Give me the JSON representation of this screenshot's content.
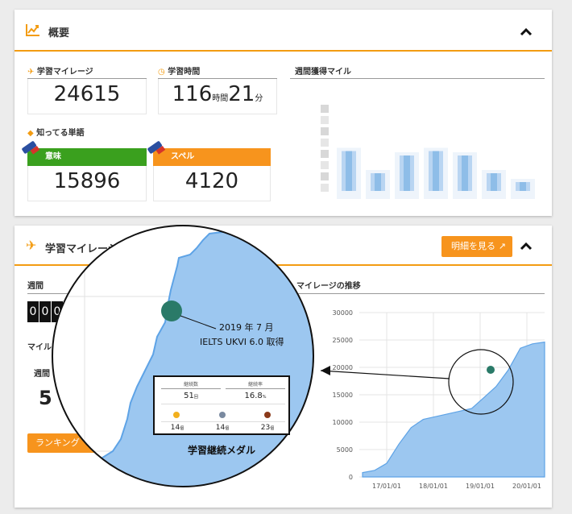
{
  "overview": {
    "title": "概要",
    "study_mileage_label": "学習マイレージ",
    "study_mileage_value": "24615",
    "study_time_label": "学習時間",
    "study_hours": "116",
    "hours_unit": "時間",
    "study_minutes": "21",
    "minutes_unit": "分",
    "weekly_label": "週間獲得マイル",
    "known_words_label": "知ってる単語",
    "meaning_label": "意味",
    "meaning_value": "15896",
    "spelling_label": "スペル",
    "spelling_value": "4120"
  },
  "mileage": {
    "title": "学習マイレージ",
    "details_button": "明細を見る",
    "week_label": "週間",
    "mile_label": "マイル",
    "week_label_2": "週間",
    "digits": [
      "0",
      "0",
      "0"
    ],
    "partial_number": "5",
    "ranking_button": "ランキング",
    "trend_label": "マイレージの推移"
  },
  "zoom": {
    "annotation_line1": "2019 年 7 月",
    "annotation_line2": "IELTS UKVI 6.0 取得",
    "medal_title": "学習継続メダル",
    "medal_col1_head": "継続数",
    "medal_col1_value": "51",
    "medal_col1_unit": "回",
    "medal_col2_head": "継続率",
    "medal_col2_value": "16.8",
    "medal_col2_unit": "%",
    "medals": [
      {
        "value": "14",
        "unit": "個",
        "color": "#f2b01e"
      },
      {
        "value": "14",
        "unit": "個",
        "color": "#7a8aa0"
      },
      {
        "value": "23",
        "unit": "個",
        "color": "#8b3a1a"
      }
    ]
  },
  "chart_data": {
    "type": "area",
    "ylim": [
      0,
      30000
    ],
    "yticks": [
      "0",
      "5000",
      "10000",
      "15000",
      "20000",
      "25000",
      "30000"
    ],
    "xticks": [
      "17/01/01",
      "18/01/01",
      "19/01/01",
      "20/01/01"
    ],
    "x": [
      "16/07",
      "17/01",
      "17/04",
      "17/07",
      "17/10",
      "18/01",
      "18/04",
      "18/07",
      "18/10",
      "19/01",
      "19/04",
      "19/06",
      "19/07",
      "19/09",
      "19/12",
      "20/03"
    ],
    "values": [
      800,
      1200,
      2500,
      6000,
      9000,
      10500,
      11000,
      11500,
      12000,
      12500,
      14500,
      16500,
      19500,
      23500,
      24300,
      24615
    ],
    "fill_color": "#9cc7f0",
    "line_color": "#5ea3e6"
  },
  "weekly_chart_data": {
    "type": "bar",
    "values": [
      0.45,
      0.2,
      0.4,
      0.45,
      0.4,
      0.2,
      0.1
    ]
  },
  "colors": {
    "accent": "#f39c12",
    "green": "#3aa01e",
    "orange": "#f7941d",
    "dark_teal": "#2a7a68"
  }
}
